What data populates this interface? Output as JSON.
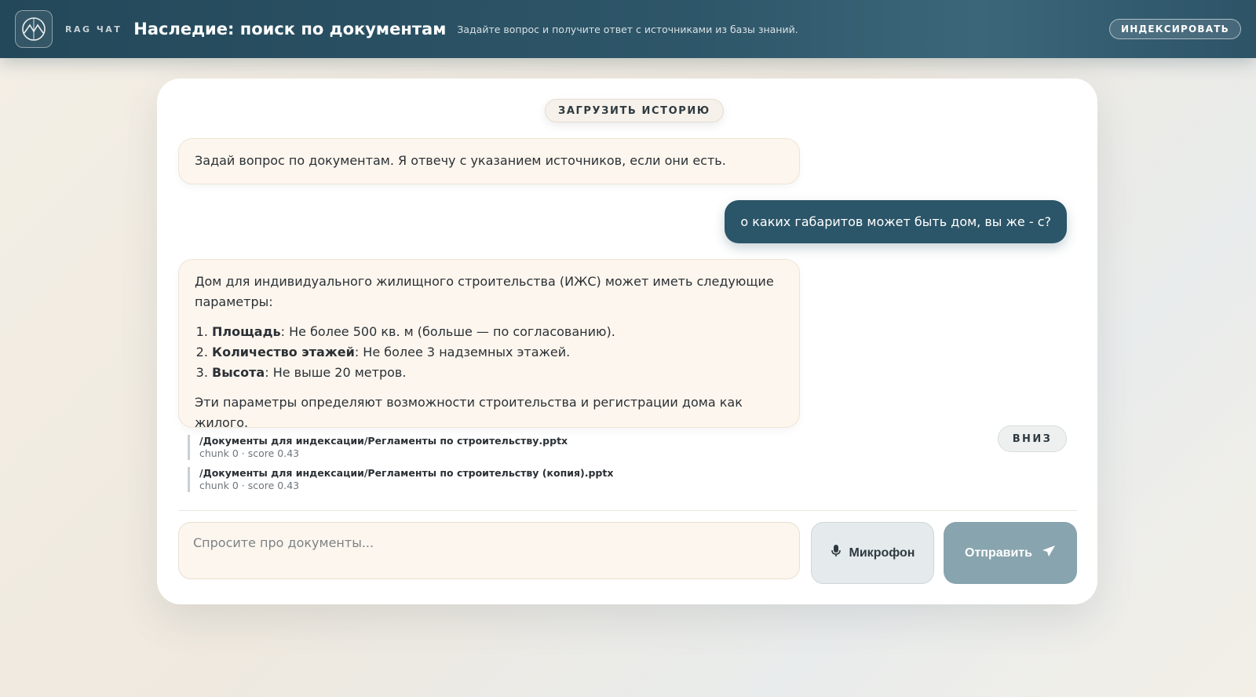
{
  "header": {
    "brand_small": "RAG ЧАТ",
    "title": "Наследие: поиск по документам",
    "subtitle": "Задайте вопрос и получите ответ с источниками из базы знаний.",
    "index_button": "ИНДЕКСИРОВАТЬ"
  },
  "chat": {
    "load_history": "ЗАГРУЗИТЬ ИСТОРИЮ",
    "greeting": "Задай вопрос по документам. Я отвечу с указанием источников, если они есть.",
    "user_message": "о каких габаритов может быть дом, вы же - с?",
    "answer": {
      "intro": "Дом для индивидуального жилищного строительства (ИЖС) может иметь следующие параметры:",
      "items": [
        {
          "label": "Площадь",
          "text": ": Не более 500 кв. м (больше — по согласованию)."
        },
        {
          "label": "Количество этажей",
          "text": ": Не более 3 надземных этажей."
        },
        {
          "label": "Высота",
          "text": ": Не выше 20 метров."
        }
      ],
      "outro": "Эти параметры определяют возможности строительства и регистрации дома как жилого."
    },
    "sources": [
      {
        "path": "/Документы для индексации/Регламенты по строительству.pptx",
        "meta": "chunk 0 · score 0.43"
      },
      {
        "path": "/Документы для индексации/Регламенты по строительству (копия).pptx",
        "meta": "chunk 0 · score 0.43"
      }
    ],
    "down_button": "ВНИЗ"
  },
  "composer": {
    "placeholder": "Спросите про документы...",
    "value": "",
    "mic_label": "Микрофон",
    "send_label": "Отправить"
  },
  "colors": {
    "header_bg": "#2b5266",
    "user_bubble": "#2b5568",
    "bot_bubble": "#fdf6ee",
    "send_button": "#88a4ae"
  },
  "icons": {
    "logo": "heritage-logo-icon",
    "mic": "microphone-icon",
    "send": "send-arrow-icon"
  }
}
